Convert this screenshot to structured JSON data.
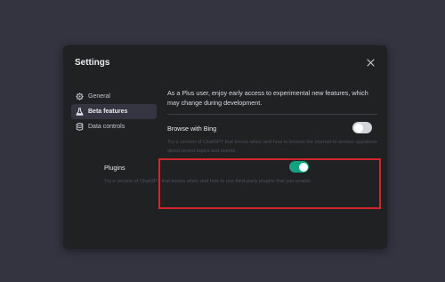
{
  "modal": {
    "title": "Settings"
  },
  "sidebar": {
    "items": [
      {
        "label": "General",
        "icon": "gear-icon",
        "active": false
      },
      {
        "label": "Beta features",
        "icon": "flask-icon",
        "active": true
      },
      {
        "label": "Data controls",
        "icon": "database-icon",
        "active": false
      }
    ]
  },
  "beta": {
    "intro": "As a Plus user, enjoy early access to experimental new features, which may change during development.",
    "browse": {
      "label": "Browse with Bing",
      "description": "Try a version of ChatGPT that knows when and how to browse the internet to answer questions about recent topics and events.",
      "enabled": false
    },
    "plugins": {
      "label": "Plugins",
      "description": "Try a version of ChatGPT that knows when and how to use third-party plugins that you enable.",
      "enabled": true
    }
  },
  "colors": {
    "accent": "#10a37f",
    "highlight": "#d0262c",
    "modal_bg": "#202123"
  }
}
